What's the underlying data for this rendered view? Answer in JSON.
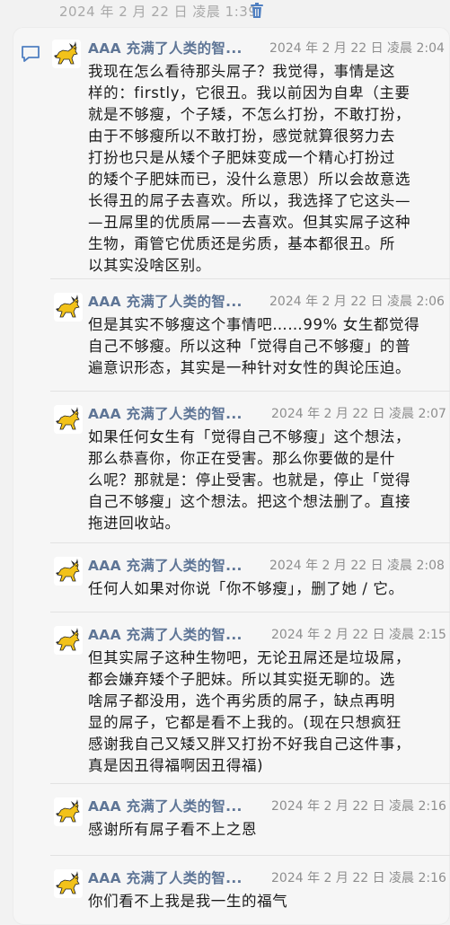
{
  "header": {
    "timestamp": "2024 年 2 月 22 日 凌晨 1:39"
  },
  "messages": [
    {
      "author": "AAA 充满了人类的智...",
      "time": "2024 年 2 月 22 日 凌晨 2:04",
      "lines": [
        "我现在怎么看待那头屌子？我觉得，事情是这",
        "样的：firstly，它很丑。我以前因为自卑（主要",
        "就是不够瘦，个子矮，不怎么打扮，不敢打扮，",
        "由于不够瘦所以不敢打扮，感觉就算很努力去",
        "打扮也只是从矮个子肥妹变成一个精心打扮过",
        "的矮个子肥妹而已，没什么意思）所以会故意选",
        "长得丑的屌子去喜欢。所以，我选择了它这头—",
        "—丑屌里的优质屌——去喜欢。但其实屌子这种",
        "生物，甭管它优质还是劣质，基本都很丑。所",
        "以其实没啥区别。"
      ]
    },
    {
      "author": "AAA 充满了人类的智...",
      "time": "2024 年 2 月 22 日 凌晨 2:06",
      "lines": [
        "但是其实不够瘦这个事情吧……99% 女生都觉得",
        "自己不够瘦。所以这种「觉得自己不够瘦」的普",
        "遍意识形态，其实是一种针对女性的舆论压迫。"
      ]
    },
    {
      "author": "AAA 充满了人类的智...",
      "time": "2024 年 2 月 22 日 凌晨 2:07",
      "lines": [
        "如果任何女生有「觉得自己不够瘦」这个想法，",
        "那么恭喜你，你正在受害。那么你要做的是什",
        "么呢？那就是：停止受害。也就是，停止「觉得",
        "自己不够瘦」这个想法。把这个想法删了。直接",
        "拖进回收站。"
      ]
    },
    {
      "author": "AAA 充满了人类的智...",
      "time": "2024 年 2 月 22 日 凌晨 2:08",
      "lines": [
        "任何人如果对你说「你不够瘦」，删了她 / 它。"
      ]
    },
    {
      "author": "AAA 充满了人类的智...",
      "time": "2024 年 2 月 22 日 凌晨 2:15",
      "lines": [
        "但其实屌子这种生物吧，无论丑屌还是垃圾屌，",
        "都会嫌弃矮个子肥妹。所以其实挺无聊的。选",
        "啥屌子都没用，选个再劣质的屌子，缺点再明",
        "显的屌子，它都是看不上我的。(现在只想疯狂",
        "感谢我自己又矮又胖又打扮不好我自己这件事，",
        "真是因丑得福啊因丑得福)"
      ]
    },
    {
      "author": "AAA 充满了人类的智...",
      "time": "2024 年 2 月 22 日 凌晨 2:16",
      "lines": [
        "感谢所有屌子看不上之恩"
      ]
    },
    {
      "author": "AAA 充满了人类的智...",
      "time": "2024 年 2 月 22 日 凌晨 2:16",
      "lines": [
        "你们看不上我是我一生的福气"
      ]
    }
  ]
}
